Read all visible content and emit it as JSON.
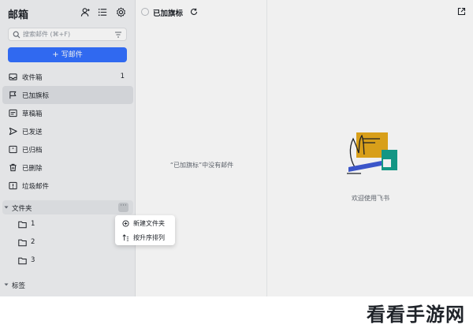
{
  "app": {
    "title": "邮箱"
  },
  "search": {
    "placeholder": "搜索邮件 (⌘+F)"
  },
  "compose": {
    "label": "写邮件"
  },
  "nav": {
    "items": [
      {
        "label": "收件箱",
        "count": "1",
        "icon": "inbox-icon"
      },
      {
        "label": "已加旗标",
        "count": "",
        "icon": "flag-icon"
      },
      {
        "label": "草稿箱",
        "count": "",
        "icon": "draft-icon"
      },
      {
        "label": "已发送",
        "count": "",
        "icon": "send-icon"
      },
      {
        "label": "已归档",
        "count": "",
        "icon": "archive-icon"
      },
      {
        "label": "已删除",
        "count": "",
        "icon": "trash-icon"
      },
      {
        "label": "垃圾邮件",
        "count": "",
        "icon": "spam-icon"
      }
    ]
  },
  "folders": {
    "label": "文件夹",
    "more_label": "···",
    "items": [
      {
        "label": "1"
      },
      {
        "label": "2"
      },
      {
        "label": "3"
      }
    ]
  },
  "context_menu": {
    "items": [
      {
        "label": "新建文件夹",
        "icon": "add-circle-icon"
      },
      {
        "label": "按升序排列",
        "icon": "sort-ascending-icon"
      }
    ]
  },
  "tags": {
    "label": "标签"
  },
  "list": {
    "title": "已加旗标",
    "empty_text": "“已加旗标”中没有邮件"
  },
  "reader": {
    "welcome_text": "欢迎使用飞书"
  },
  "watermark": {
    "text": "看看手游网"
  },
  "colors": {
    "accent": "#3370ff",
    "sidebar_bg": "#f2f3f5",
    "active_bg": "#dfe1e5"
  }
}
